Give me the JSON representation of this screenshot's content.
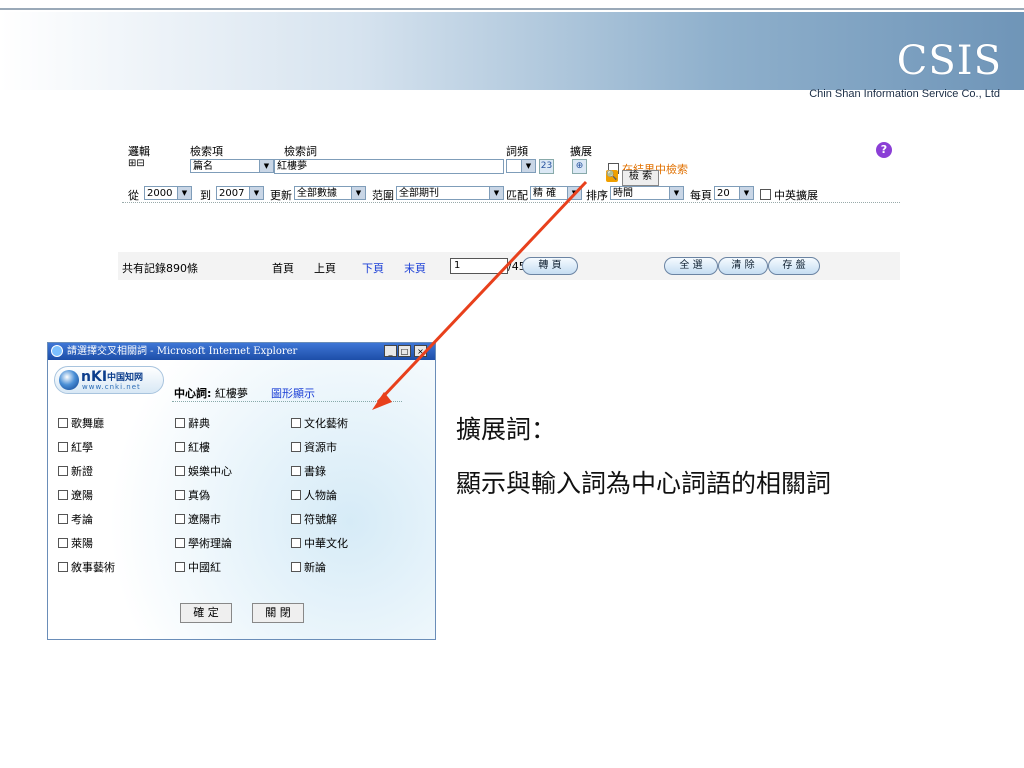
{
  "header": {
    "logo": "CSIS",
    "company": "Chin Shan Information Service Co., Ltd"
  },
  "form": {
    "col_logic": "邏輯",
    "col_field": "檢索項",
    "col_term": "檢索詞",
    "col_freq": "詞頻",
    "col_expand": "擴展",
    "plus_minus": "⊞⊟",
    "field_value": "篇名",
    "term_value": "紅樓夢",
    "search_in_results": "在結果中檢索",
    "search_button": "檢 索",
    "from_label": "從",
    "from_value": "2000",
    "to_label": "到",
    "to_value": "2007",
    "update_label": "更新",
    "update_value": "全部數據",
    "scope_label": "范圍",
    "scope_value": "全部期刊",
    "match_label": "匹配",
    "match_value": "精 確",
    "sort_label": "排序",
    "sort_value": "時間",
    "per_page_label": "每頁",
    "per_page_value": "20",
    "cn_en_expand": "中英擴展",
    "help_icon": "?"
  },
  "pager": {
    "total": "共有記錄890條",
    "first": "首頁",
    "prev": "上頁",
    "next": "下頁",
    "last": "末頁",
    "page_value": "1",
    "page_total": "/45",
    "goto": "轉 頁",
    "select_all": "全 選",
    "clear": "清 除",
    "save": "存 盤"
  },
  "popup": {
    "title": "請選擇交叉相關詞 - Microsoft Internet Explorer",
    "min": "_",
    "max": "□",
    "close": "×",
    "logo_n": "nKI",
    "logo_cn": "中国知网",
    "logo_www": "www.cnki.net",
    "center_label": "中心詞:",
    "center_value": "紅樓夢",
    "graph_link": "圖形顯示",
    "terms": [
      [
        "歌舞廳",
        "辭典",
        "文化藝術"
      ],
      [
        "紅學",
        "紅樓",
        "資源市"
      ],
      [
        "新證",
        "娛樂中心",
        "書錄"
      ],
      [
        "遼陽",
        "真偽",
        "人物論"
      ],
      [
        "考論",
        "遼陽市",
        "符號解"
      ],
      [
        "萊陽",
        "學術理論",
        "中華文化"
      ],
      [
        "敘事藝術",
        "中國紅",
        "新論"
      ]
    ],
    "ok": "確 定",
    "close_btn": "關 閉"
  },
  "caption": {
    "line1": "擴展詞：",
    "line2": "顯示與輸入詞為中心詞語的相關詞"
  },
  "colors": {
    "arrow": "#e8401c",
    "link": "#1b3fd6",
    "titlebar": "#1d4ea8"
  }
}
